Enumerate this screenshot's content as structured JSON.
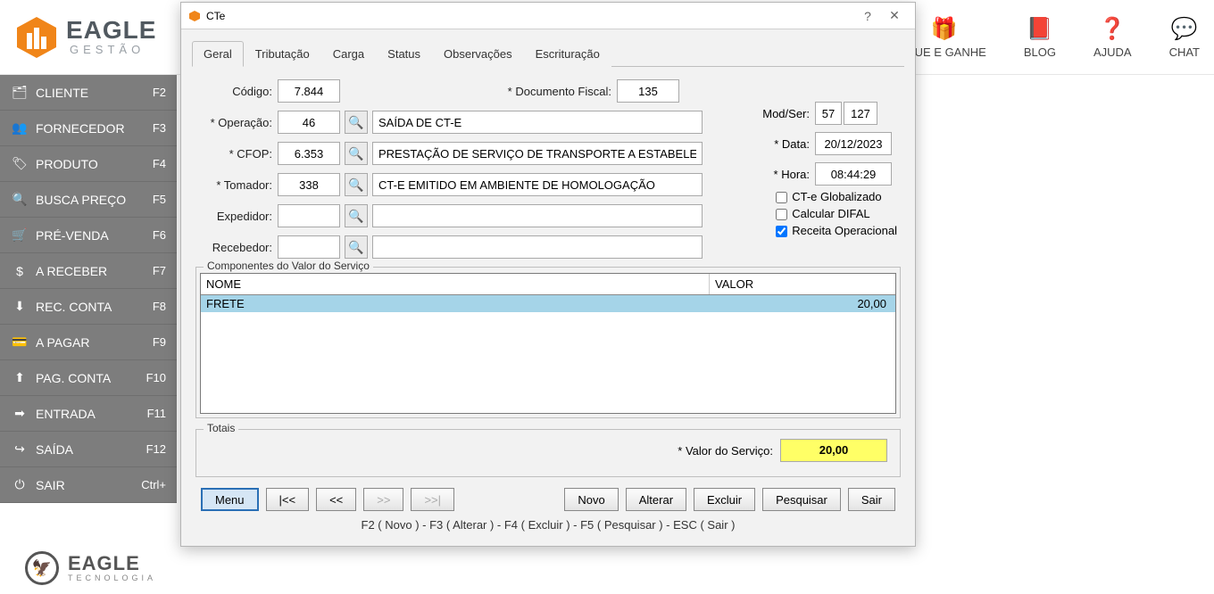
{
  "header": {
    "logo_title": "EAGLE",
    "logo_sub": "GESTÃO",
    "items": [
      {
        "icon": "🎁",
        "label": "IQUE E GANHE"
      },
      {
        "icon": "📕",
        "label": "BLOG"
      },
      {
        "icon": "❓",
        "label": "AJUDA"
      },
      {
        "icon": "💬",
        "label": "CHAT"
      }
    ]
  },
  "sidebar": [
    {
      "icon": "🗂",
      "label": "CLIENTE",
      "key": "F2"
    },
    {
      "icon": "👥",
      "label": "FORNECEDOR",
      "key": "F3"
    },
    {
      "icon": "🏷",
      "label": "PRODUTO",
      "key": "F4"
    },
    {
      "icon": "🔍",
      "label": "BUSCA PREÇO",
      "key": "F5"
    },
    {
      "icon": "🛒",
      "label": "PRÉ-VENDA",
      "key": "F6"
    },
    {
      "icon": "$",
      "label": "A RECEBER",
      "key": "F7"
    },
    {
      "icon": "⬇",
      "label": "REC. CONTA",
      "key": "F8"
    },
    {
      "icon": "💳",
      "label": "A PAGAR",
      "key": "F9"
    },
    {
      "icon": "⬆",
      "label": "PAG. CONTA",
      "key": "F10"
    },
    {
      "icon": "➡",
      "label": "ENTRADA",
      "key": "F11"
    },
    {
      "icon": "↪",
      "label": "SAÍDA",
      "key": "F12"
    },
    {
      "icon": "⏻",
      "label": "SAIR",
      "key": "Ctrl+"
    }
  ],
  "footer": {
    "title": "EAGLE",
    "sub": "TECNOLOGIA"
  },
  "dialog": {
    "title": "CTe",
    "tabs": [
      "Geral",
      "Tributação",
      "Carga",
      "Status",
      "Observações",
      "Escrituração"
    ],
    "labels": {
      "codigo": "Código:",
      "doc": "* Documento Fiscal:",
      "modser": "Mod/Ser:",
      "operacao": "* Operação:",
      "cfop": "* CFOP:",
      "tomador": "* Tomador:",
      "expedidor": "Expedidor:",
      "recebedor": "Recebedor:",
      "data": "* Data:",
      "hora": "* Hora:",
      "componentes": "Componentes do Valor do Serviço",
      "nome": "NOME",
      "valor": "VALOR",
      "totais": "Totais",
      "valorserv": "* Valor do Serviço:"
    },
    "values": {
      "codigo": "7.844",
      "doc": "135",
      "mod": "57",
      "ser": "127",
      "operacao_cod": "46",
      "operacao_desc": "SAÍDA DE CT-E",
      "cfop_cod": "6.353",
      "cfop_desc": "PRESTAÇÃO DE SERVIÇO DE TRANSPORTE A ESTABELEC",
      "tomador_cod": "338",
      "tomador_desc": "CT-E EMITIDO EM AMBIENTE DE HOMOLOGAÇÃO",
      "expedidor_cod": "",
      "expedidor_desc": "",
      "recebedor_cod": "",
      "recebedor_desc": "",
      "data": "20/12/2023",
      "hora": "08:44:29",
      "valorserv": "20,00"
    },
    "checks": {
      "globalizado": {
        "label": "CT-e Globalizado",
        "checked": false
      },
      "difal": {
        "label": "Calcular DIFAL",
        "checked": false
      },
      "receita": {
        "label": "Receita Operacional",
        "checked": true
      }
    },
    "componentes": [
      {
        "nome": "FRETE",
        "valor": "20,00"
      }
    ],
    "buttons": {
      "menu": "Menu",
      "first": "|<<",
      "prev": "<<",
      "next": ">>",
      "last": ">>|",
      "novo": "Novo",
      "alterar": "Alterar",
      "excluir": "Excluir",
      "pesquisar": "Pesquisar",
      "sair": "Sair"
    },
    "hint": "F2 ( Novo )   -   F3 ( Alterar )   -   F4 ( Excluir )   -   F5 ( Pesquisar )   -   ESC ( Sair )"
  }
}
